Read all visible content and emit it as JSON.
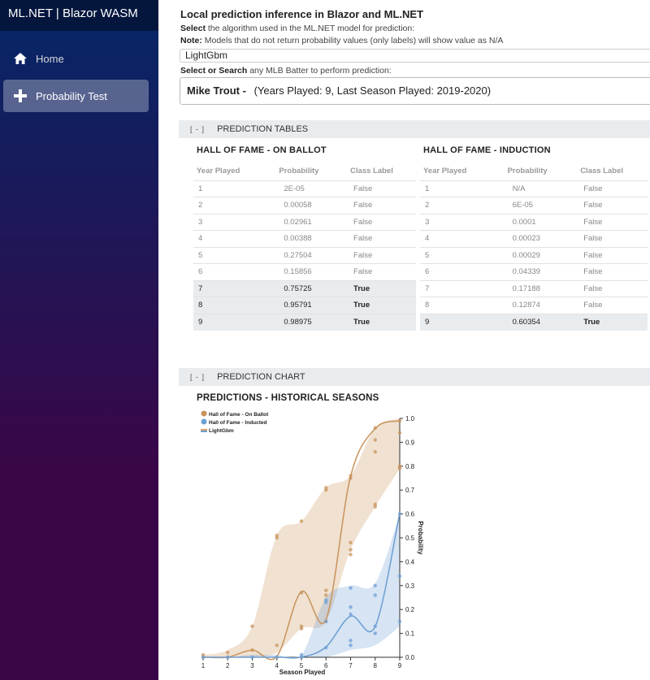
{
  "app": {
    "brand": "ML.NET | Blazor WASM"
  },
  "nav": {
    "home": "Home",
    "probability_test": "Probability Test"
  },
  "page": {
    "title": "Local prediction inference in Blazor and ML.NET",
    "algo_prompt_bold": "Select",
    "algo_prompt_rest": " the algorithm used in the ML.NET model for prediction:",
    "note_bold": "Note:",
    "note_rest": " Models that do not return probability values (only labels) will show value as N/A",
    "algorithm_value": "LightGbm",
    "search_prompt_bold": "Select or Search",
    "search_prompt_rest": " any MLB Batter to perform prediction:",
    "player_name": "Mike Trout -",
    "player_details": "(Years Played: 9, Last Season Played: 2019-2020)"
  },
  "sections": {
    "tables_toggle": "[ - ]",
    "tables_label": "PREDICTION TABLES",
    "chart_toggle": "[ - ]",
    "chart_label": "PREDICTION CHART"
  },
  "tables": {
    "columns": [
      "Year Played",
      "Probability",
      "Class Label"
    ],
    "on_ballot": {
      "title": "HALL OF FAME - ON BALLOT",
      "rows": [
        [
          "1",
          "2E-05",
          "False"
        ],
        [
          "2",
          "0.00058",
          "False"
        ],
        [
          "3",
          "0.02961",
          "False"
        ],
        [
          "4",
          "0.00388",
          "False"
        ],
        [
          "5",
          "0.27504",
          "False"
        ],
        [
          "6",
          "0.15856",
          "False"
        ],
        [
          "7",
          "0.75725",
          "True"
        ],
        [
          "8",
          "0.95791",
          "True"
        ],
        [
          "9",
          "0.98975",
          "True"
        ]
      ]
    },
    "induction": {
      "title": "HALL OF FAME - INDUCTION",
      "rows": [
        [
          "1",
          "N/A",
          "False"
        ],
        [
          "2",
          "6E-05",
          "False"
        ],
        [
          "3",
          "0.0001",
          "False"
        ],
        [
          "4",
          "0.00023",
          "False"
        ],
        [
          "5",
          "0.00029",
          "False"
        ],
        [
          "6",
          "0.04339",
          "False"
        ],
        [
          "7",
          "0.17188",
          "False"
        ],
        [
          "8",
          "0.12874",
          "False"
        ],
        [
          "9",
          "0.60354",
          "True"
        ]
      ]
    }
  },
  "chart_data": {
    "type": "line",
    "title": "PREDICTIONS - HISTORICAL SEASONS",
    "xlabel": "Season Played",
    "ylabel": "Probability",
    "x": [
      1,
      2,
      3,
      4,
      5,
      6,
      7,
      8,
      9
    ],
    "xlim": [
      1,
      9
    ],
    "ylim": [
      0,
      1.0
    ],
    "y_ticks": [
      "0.0",
      "0.1",
      "0.2",
      "0.3",
      "0.4",
      "0.5",
      "0.6",
      "0.7",
      "0.8",
      "0.9",
      "1.0"
    ],
    "legend_position": "top-left",
    "series": [
      {
        "name": "Hall of Fame - On Ballot",
        "color": "#c8935a",
        "values": [
          2e-05,
          0.00058,
          0.02961,
          0.00388,
          0.27504,
          0.15856,
          0.75725,
          0.95791,
          0.98975
        ],
        "band_upper": [
          0.01,
          0.03,
          0.13,
          0.51,
          0.57,
          0.71,
          0.76,
          0.96,
          1.0
        ],
        "band_lower": [
          0.0,
          0.0,
          0.0,
          0.02,
          0.12,
          0.15,
          0.45,
          0.63,
          0.79
        ],
        "scatter": [
          [
            1,
            0.0
          ],
          [
            1,
            0.01
          ],
          [
            2,
            0.0
          ],
          [
            2,
            0.02
          ],
          [
            3,
            0.03
          ],
          [
            3,
            0.13
          ],
          [
            4,
            0.0
          ],
          [
            4,
            0.05
          ],
          [
            4,
            0.5
          ],
          [
            4,
            0.51
          ],
          [
            5,
            0.12
          ],
          [
            5,
            0.13
          ],
          [
            5,
            0.27
          ],
          [
            5,
            0.57
          ],
          [
            6,
            0.15
          ],
          [
            6,
            0.26
          ],
          [
            6,
            0.28
          ],
          [
            6,
            0.7
          ],
          [
            6,
            0.71
          ],
          [
            7,
            0.43
          ],
          [
            7,
            0.45
          ],
          [
            7,
            0.48
          ],
          [
            7,
            0.75
          ],
          [
            7,
            0.76
          ],
          [
            8,
            0.63
          ],
          [
            8,
            0.64
          ],
          [
            8,
            0.86
          ],
          [
            8,
            0.91
          ],
          [
            8,
            0.96
          ],
          [
            9,
            0.79
          ],
          [
            9,
            0.8
          ],
          [
            9,
            0.94
          ],
          [
            9,
            0.99
          ]
        ]
      },
      {
        "name": "Hall of Fame - Inducted",
        "color": "#6d9ed3",
        "values": [
          0.0,
          6e-05,
          0.0001,
          0.00023,
          0.00029,
          0.04339,
          0.17188,
          0.12874,
          0.60354
        ],
        "band_upper": [
          0.0,
          0.0,
          0.01,
          0.01,
          0.01,
          0.25,
          0.3,
          0.31,
          0.6
        ],
        "band_lower": [
          0.0,
          0.0,
          0.0,
          0.0,
          0.0,
          0.0,
          0.03,
          0.05,
          0.13
        ],
        "scatter": [
          [
            1,
            0.0
          ],
          [
            2,
            0.0
          ],
          [
            3,
            0.0
          ],
          [
            4,
            0.0
          ],
          [
            5,
            0.0
          ],
          [
            5,
            0.01
          ],
          [
            6,
            0.04
          ],
          [
            6,
            0.15
          ],
          [
            6,
            0.23
          ],
          [
            6,
            0.24
          ],
          [
            7,
            0.05
          ],
          [
            7,
            0.07
          ],
          [
            7,
            0.18
          ],
          [
            7,
            0.21
          ],
          [
            7,
            0.29
          ],
          [
            8,
            0.1
          ],
          [
            8,
            0.13
          ],
          [
            8,
            0.26
          ],
          [
            8,
            0.3
          ],
          [
            9,
            0.15
          ],
          [
            9,
            0.34
          ],
          [
            9,
            0.6
          ]
        ]
      },
      {
        "name": "LightGbm",
        "color": "#e0a060",
        "legend_only": true
      }
    ]
  }
}
